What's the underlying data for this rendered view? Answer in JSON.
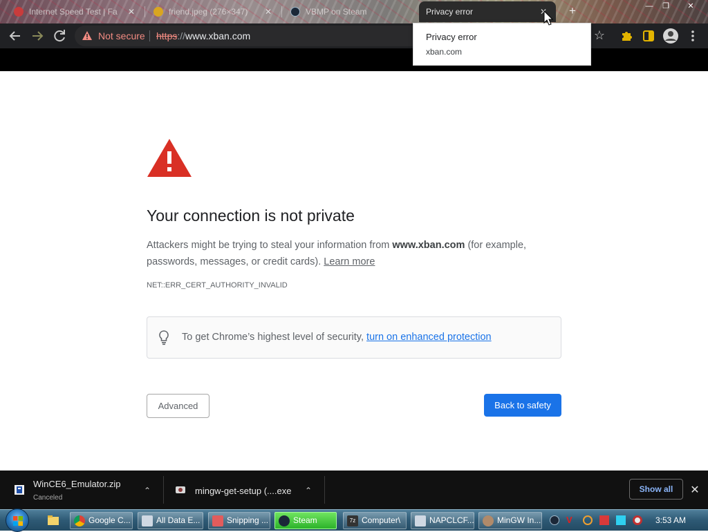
{
  "tabs": [
    {
      "title": "Internet Speed Test | Fa",
      "close": "✕"
    },
    {
      "title": "friend.jpeg (276×347)",
      "close": "✕"
    },
    {
      "title": "VBMP on Steam",
      "close": "✕"
    },
    {
      "title": "Privacy error",
      "close": "✕"
    }
  ],
  "window": {
    "minimize": "—",
    "maximize": "❐",
    "close": "✕",
    "new_tab": "+"
  },
  "toolbar": {
    "status": "Not secure",
    "url_scheme": "https",
    "url_sep": "://",
    "url_host": "www.xban.com"
  },
  "tooltip": {
    "title": "Privacy error",
    "host": "xban.com"
  },
  "interstitial": {
    "heading": "Your connection is not private",
    "desc_prefix": "Attackers might be trying to steal your information from ",
    "desc_host": "www.xban.com",
    "desc_suffix": " (for example, passwords, messages, or credit cards). ",
    "learn_more": "Learn more",
    "error_code": "NET::ERR_CERT_AUTHORITY_INVALID",
    "security_prefix": "To get Chrome’s highest level of security, ",
    "security_link": "turn on enhanced protection",
    "advanced_button": "Advanced",
    "safety_button": "Back to safety"
  },
  "downloads": {
    "items": [
      {
        "name": "WinCE6_Emulator.zip",
        "status": "Canceled"
      },
      {
        "name": "mingw-get-setup (....exe",
        "status": ""
      }
    ],
    "show_all": "Show all"
  },
  "taskbar": {
    "items": [
      {
        "label": "Google C..."
      },
      {
        "label": "All Data E..."
      },
      {
        "label": "Snipping ..."
      },
      {
        "label": "Steam"
      },
      {
        "label": "Computer\\"
      },
      {
        "label": "NAPCLCF..."
      },
      {
        "label": "MinGW In..."
      }
    ],
    "clock": "3:53 AM"
  },
  "colors": {
    "warning_red": "#d93025",
    "link_blue": "#1a73e8",
    "primary_button": "#1a73e8"
  }
}
